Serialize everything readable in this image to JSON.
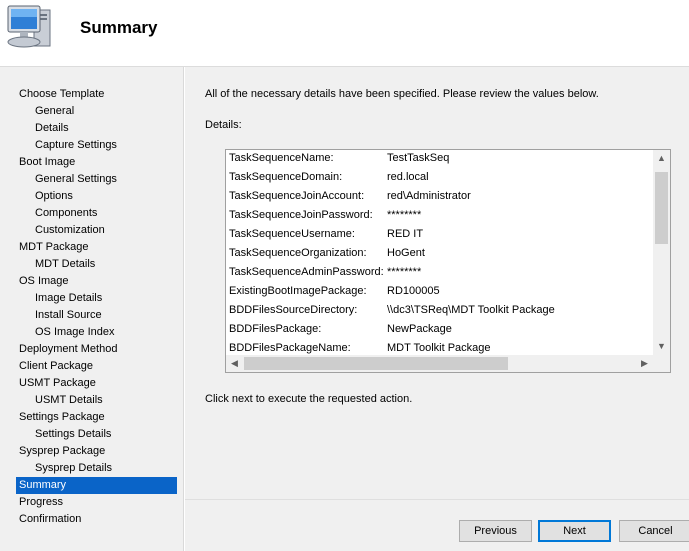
{
  "header": {
    "title": "Summary",
    "icon": "computer-monitor-icon"
  },
  "nav": [
    {
      "label": "Choose Template",
      "level": 1,
      "active": false
    },
    {
      "label": "General",
      "level": 2,
      "active": false
    },
    {
      "label": "Details",
      "level": 2,
      "active": false
    },
    {
      "label": "Capture Settings",
      "level": 2,
      "active": false
    },
    {
      "label": "Boot Image",
      "level": 1,
      "active": false
    },
    {
      "label": "General Settings",
      "level": 2,
      "active": false
    },
    {
      "label": "Options",
      "level": 2,
      "active": false
    },
    {
      "label": "Components",
      "level": 2,
      "active": false
    },
    {
      "label": "Customization",
      "level": 2,
      "active": false
    },
    {
      "label": "MDT Package",
      "level": 1,
      "active": false
    },
    {
      "label": "MDT Details",
      "level": 2,
      "active": false
    },
    {
      "label": "OS Image",
      "level": 1,
      "active": false
    },
    {
      "label": "Image Details",
      "level": 2,
      "active": false
    },
    {
      "label": "Install Source",
      "level": 2,
      "active": false
    },
    {
      "label": "OS Image Index",
      "level": 2,
      "active": false
    },
    {
      "label": "Deployment Method",
      "level": 1,
      "active": false
    },
    {
      "label": "Client Package",
      "level": 1,
      "active": false
    },
    {
      "label": "USMT Package",
      "level": 1,
      "active": false
    },
    {
      "label": "USMT Details",
      "level": 2,
      "active": false
    },
    {
      "label": "Settings Package",
      "level": 1,
      "active": false
    },
    {
      "label": "Settings Details",
      "level": 2,
      "active": false
    },
    {
      "label": "Sysprep Package",
      "level": 1,
      "active": false
    },
    {
      "label": "Sysprep Details",
      "level": 2,
      "active": false
    },
    {
      "label": "Summary",
      "level": 1,
      "active": true
    },
    {
      "label": "Progress",
      "level": 1,
      "active": false
    },
    {
      "label": "Confirmation",
      "level": 1,
      "active": false
    }
  ],
  "main": {
    "intro": "All of the necessary details have been specified.  Please review the values below.",
    "details_label": "Details:",
    "details": [
      {
        "key": "TaskSequenceName:",
        "value": "TestTaskSeq"
      },
      {
        "key": "TaskSequenceDomain:",
        "value": "red.local"
      },
      {
        "key": "TaskSequenceJoinAccount:",
        "value": "red\\Administrator"
      },
      {
        "key": "TaskSequenceJoinPassword:",
        "value": "********"
      },
      {
        "key": "TaskSequenceUsername:",
        "value": "RED IT"
      },
      {
        "key": "TaskSequenceOrganization:",
        "value": "HoGent"
      },
      {
        "key": "TaskSequenceAdminPassword:",
        "value": "********"
      },
      {
        "key": "ExistingBootImagePackage:",
        "value": "RD100005"
      },
      {
        "key": "BDDFilesSourceDirectory:",
        "value": "\\\\dc3\\TSReq\\MDT Toolkit Package"
      },
      {
        "key": "BDDFilesPackage:",
        "value": "NewPackage"
      },
      {
        "key": "BDDFilesPackageName:",
        "value": "MDT Toolkit Package"
      }
    ],
    "click_next": "Click next to execute the requested action."
  },
  "buttons": {
    "previous": "Previous",
    "next": "Next",
    "cancel": "Cancel"
  },
  "colors": {
    "selection": "#0a64c8",
    "default_button_border": "#0078d7"
  }
}
